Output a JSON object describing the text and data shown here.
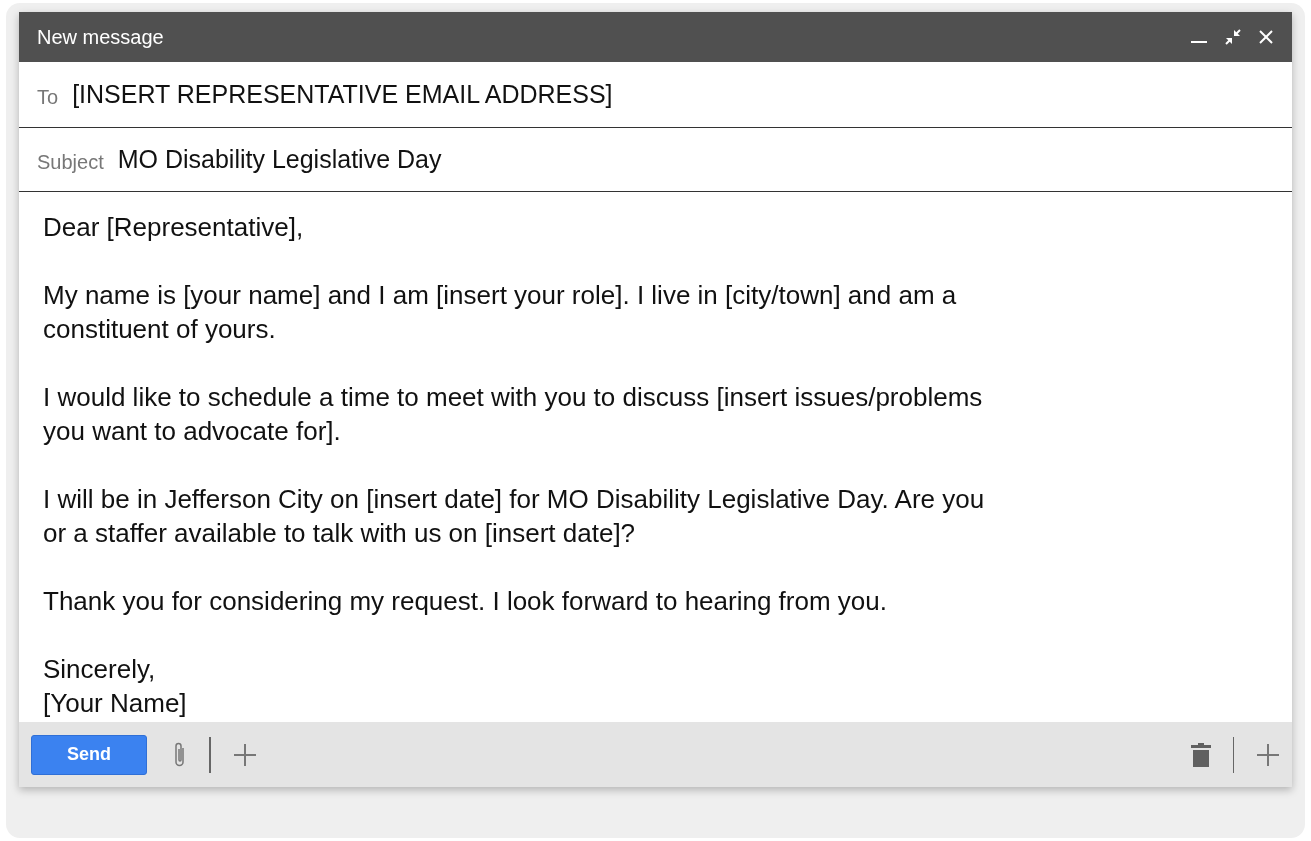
{
  "window": {
    "title": "New message"
  },
  "to": {
    "label": "To",
    "value": "[INSERT REPRESENTATIVE EMAIL ADDRESS]"
  },
  "subject": {
    "label": "Subject",
    "value": "MO Disability Legislative Day"
  },
  "body": [
    {
      "lines": [
        "Dear [Representative],"
      ]
    },
    {
      "lines": [
        "My name is [your name] and I am [insert your role]. I live in [city/town] and am a",
        "constituent of yours."
      ]
    },
    {
      "lines": [
        "I would like to schedule a time to meet with you to discuss [insert issues/problems",
        "you want to advocate for]."
      ]
    },
    {
      "lines": [
        "I will be in Jefferson City on [insert date] for MO Disability Legislative Day. Are you",
        "or a staffer available to talk with us on [insert date]?"
      ]
    },
    {
      "lines": [
        "Thank you for considering my request. I look forward to hearing from you."
      ]
    },
    {
      "lines": [
        "Sincerely,",
        "[Your Name]"
      ]
    }
  ],
  "footer": {
    "send": "Send"
  }
}
